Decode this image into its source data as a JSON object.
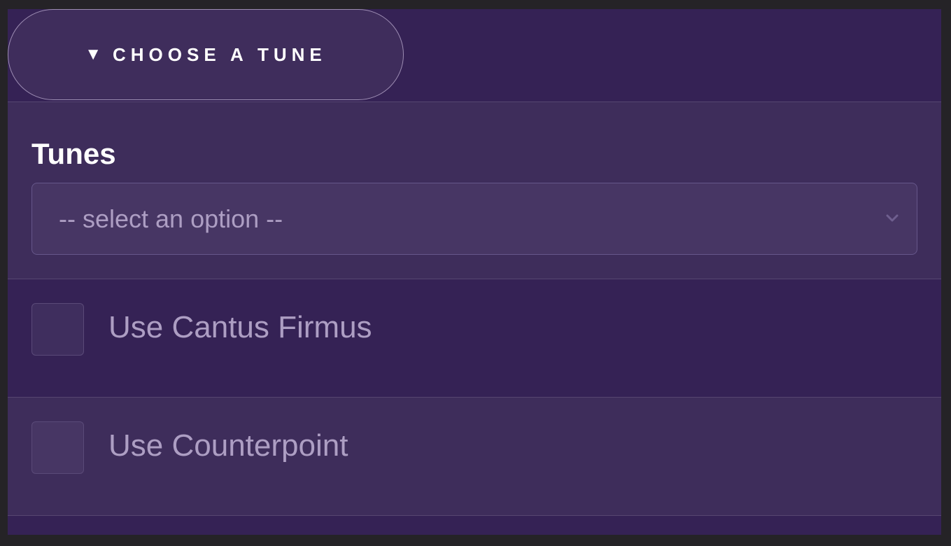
{
  "toggle": {
    "icon": "triangle-down-icon",
    "glyph": "▼",
    "label": "CHOOSE A TUNE"
  },
  "tunes": {
    "label": "Tunes",
    "select_value": "-- select an option --",
    "chevron_icon": "chevron-down-icon"
  },
  "options": [
    {
      "label": "Use Cantus Firmus",
      "checked": false
    },
    {
      "label": "Use Counterpoint",
      "checked": false
    }
  ],
  "colors": {
    "background": "#352255",
    "panel": "#3e2d5b",
    "select_bg": "#473664",
    "muted_text": "#ad9ec3",
    "border": "#9d8db3"
  }
}
